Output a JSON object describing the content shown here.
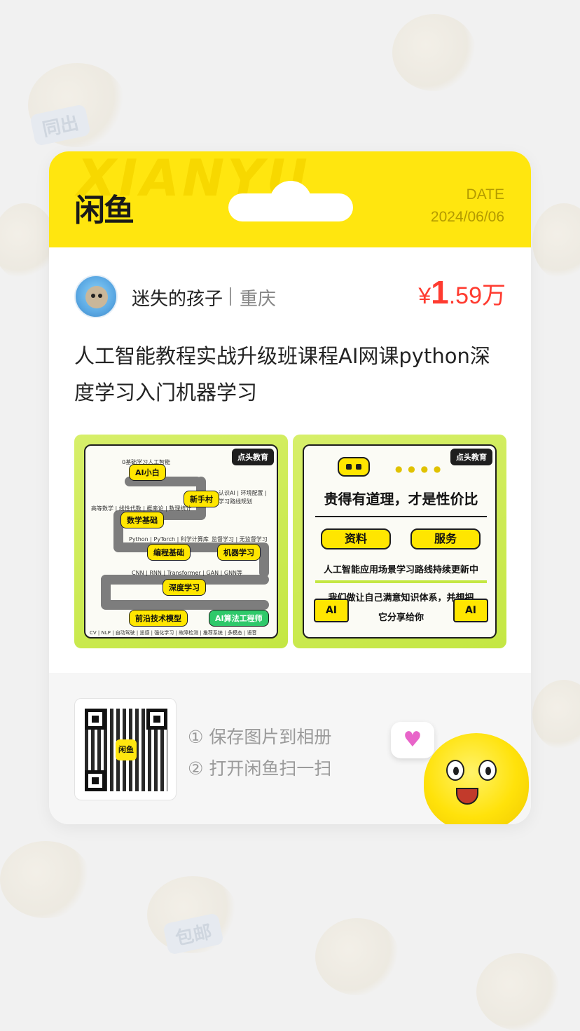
{
  "background": {
    "tags": [
      "同出",
      "包邮"
    ]
  },
  "header": {
    "watermark": "XIANYU",
    "logo": "闲鱼",
    "date_label": "DATE",
    "date_value": "2024/06/06",
    "color": "#ffe60f"
  },
  "seller": {
    "name": "迷失的孩子",
    "location": "重庆"
  },
  "price": {
    "currency": "¥",
    "integer": "1",
    "decimal": ".59",
    "unit": "万",
    "color": "#ff3b30"
  },
  "listing": {
    "title": "人工智能教程实战升级班课程AI网课python深度学习入门机器学习"
  },
  "image_left": {
    "brand": "点头教育",
    "top_caption": "0基础学习人工智能",
    "chip_start": "AI小白",
    "chip_newbie": "新手村",
    "note_newbie_1": "认识AI | 环境配置 |",
    "note_newbie_2": "学习路线规划",
    "note_math": "高等数学 | 线性代数 | 概率论 | 数理统计",
    "chip_math": "数学基础",
    "note_prog": "Python | PyTorch | 科学计算库",
    "note_ml": "监督学习 | 无监督学习",
    "chip_prog": "编程基础",
    "chip_ml": "机器学习",
    "note_dl": "CNN | RNN | Transformer | GAN | GNN等",
    "chip_dl": "深度学习",
    "chip_frontier": "前沿技术模型",
    "chip_engineer": "AI算法工程师",
    "note_bottom": "CV | NLP | 自动驾驶 | 遥感 | 强化学习 | 故障检测 | 推荐系统 | 多模态 | 语音"
  },
  "image_right": {
    "brand": "点头教育",
    "headline": "贵得有道理，才是性价比",
    "chip_materials": "资料",
    "chip_service": "服务",
    "line_1": "人工智能应用场景学习路线持续更新中",
    "line_2": "我们做让自己满意知识体系，并想把",
    "line_3": "它分享给你",
    "laptop_label": "AI"
  },
  "footer": {
    "qr_logo": "闲鱼",
    "step_1": "① 保存图片到相册",
    "step_2": "② 打开闲鱼扫一扫",
    "icons": [
      "qr-code-icon",
      "heart-icon",
      "mascot-icon"
    ]
  }
}
